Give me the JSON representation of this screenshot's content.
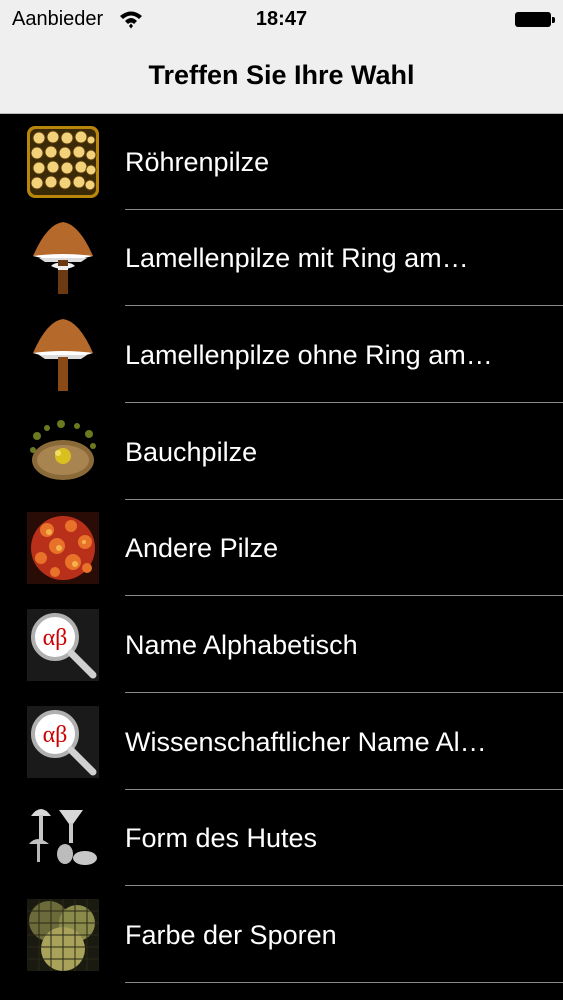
{
  "status_bar": {
    "carrier": "Aanbieder",
    "time": "18:47"
  },
  "nav": {
    "title": "Treffen Sie Ihre Wahl"
  },
  "items": [
    {
      "label": "Röhrenpilze",
      "icon": "boletus-pores-icon"
    },
    {
      "label": "Lamellenpilze mit Ring am…",
      "icon": "gilled-mushroom-ring-icon"
    },
    {
      "label": "Lamellenpilze ohne Ring am…",
      "icon": "gilled-mushroom-no-ring-icon"
    },
    {
      "label": "Bauchpilze",
      "icon": "puffball-icon"
    },
    {
      "label": "Andere Pilze",
      "icon": "other-fungi-icon"
    },
    {
      "label": "Name Alphabetisch",
      "icon": "alphabetic-search-icon",
      "icon_text": "αβ"
    },
    {
      "label": "Wissenschaftlicher Name Al…",
      "icon": "scientific-name-search-icon",
      "icon_text": "αβ"
    },
    {
      "label": "Form des Hutes",
      "icon": "cap-shapes-icon"
    },
    {
      "label": "Farbe der Sporen",
      "icon": "spore-color-icon"
    }
  ]
}
